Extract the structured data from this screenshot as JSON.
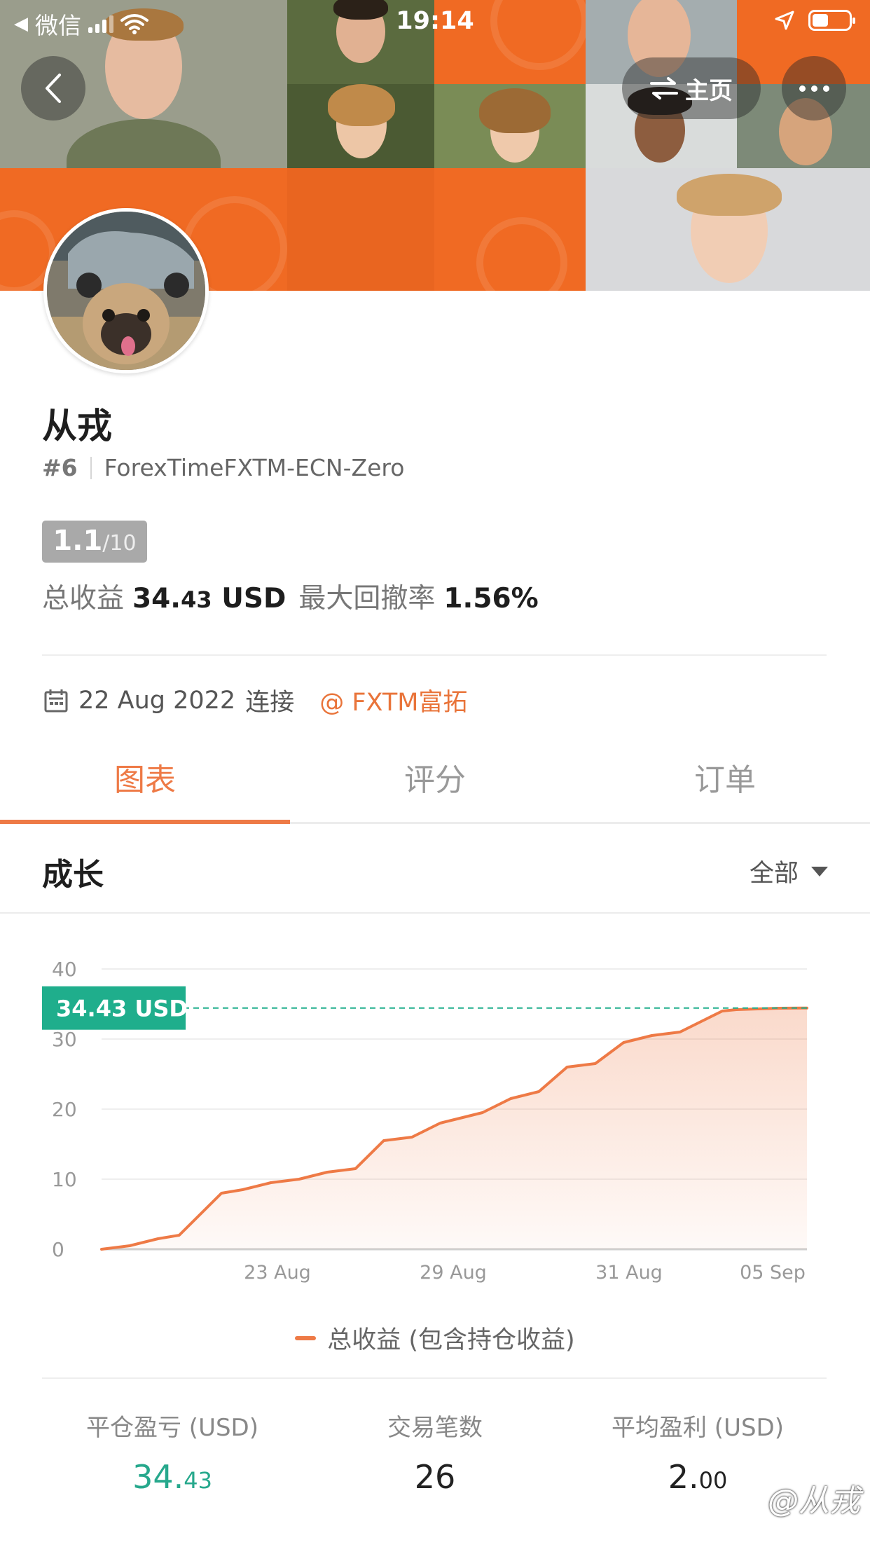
{
  "status_bar": {
    "back_app": "微信",
    "time": "19:14"
  },
  "nav": {
    "home_label": "主页"
  },
  "profile": {
    "name": "从戎",
    "rank": "#6",
    "server": "ForexTimeFXTM-ECN-Zero",
    "score": "1.1",
    "score_max": "/10",
    "total_profit_label": "总收益",
    "total_profit_int": "34.",
    "total_profit_dec": "43",
    "total_profit_unit": "USD",
    "drawdown_label": "最大回撤率",
    "drawdown_value": "1.56%",
    "connect_date": "22 Aug 2022",
    "connect_label": "连接",
    "broker": "@ FXTM富拓"
  },
  "tabs": [
    {
      "label": "图表",
      "active": true
    },
    {
      "label": "评分",
      "active": false
    },
    {
      "label": "订单",
      "active": false
    }
  ],
  "section": {
    "title": "成长",
    "filter": "全部"
  },
  "chart_data": {
    "type": "area",
    "series": [
      {
        "name": "总收益 (包含持仓收益)",
        "x": [
          0,
          0.04,
          0.08,
          0.11,
          0.14,
          0.17,
          0.2,
          0.24,
          0.28,
          0.32,
          0.36,
          0.4,
          0.44,
          0.48,
          0.5,
          0.54,
          0.58,
          0.62,
          0.66,
          0.7,
          0.74,
          0.78,
          0.82,
          0.85,
          0.88,
          0.9,
          0.93,
          0.96,
          1.0
        ],
        "values": [
          0,
          0.5,
          1.5,
          2.0,
          5.0,
          8.0,
          8.5,
          9.5,
          10.0,
          11.0,
          11.5,
          15.5,
          16.0,
          18.0,
          18.5,
          19.5,
          21.5,
          22.5,
          26.0,
          26.5,
          29.5,
          30.5,
          31.0,
          32.5,
          34.0,
          34.2,
          34.3,
          34.4,
          34.43
        ]
      }
    ],
    "x_ticks": [
      "23 Aug",
      "29 Aug",
      "31 Aug",
      "05 Sep"
    ],
    "y_ticks": [
      "0",
      "10",
      "20",
      "30",
      "40"
    ],
    "ylim": [
      0,
      40
    ],
    "current_label": "34.43 USD",
    "current_value": 34.43,
    "line_color": "#ee7a46",
    "label_color": "#1fae8c",
    "legend": "总收益 (包含持仓收益)"
  },
  "bottom_stats": [
    {
      "label": "平仓盈亏 (USD)",
      "int": "34.",
      "dec": "43"
    },
    {
      "label": "交易笔数",
      "int": "26",
      "dec": ""
    },
    {
      "label": "平均盈利 (USD)",
      "int": "2.",
      "dec": "00"
    }
  ],
  "watermark": "@从戎"
}
